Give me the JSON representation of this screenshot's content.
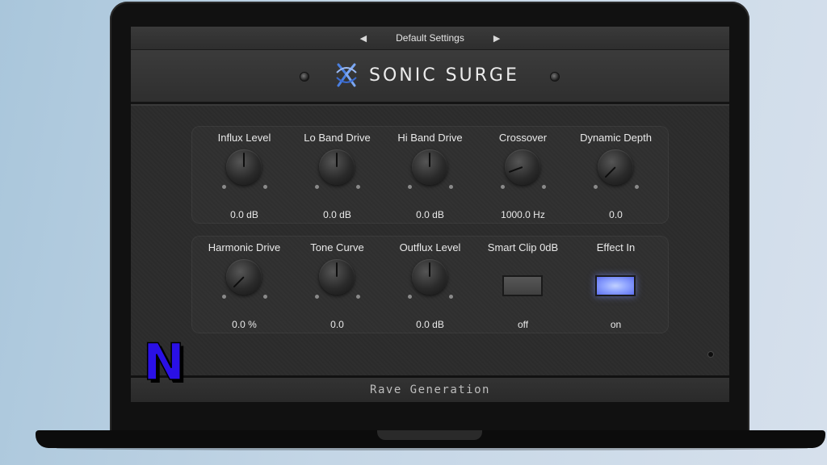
{
  "preset": {
    "name": "Default Settings",
    "prev_icon": "triangle-left-icon",
    "next_icon": "triangle-right-icon"
  },
  "brand": {
    "name": "SONIC SURGE",
    "footer": "Rave Generation",
    "badge": "N"
  },
  "colors": {
    "toggle_on": "#8fa4ff",
    "badge": "#2a10e6",
    "panel": "#2c2c2c"
  },
  "controls_row1": [
    {
      "label": "Influx Level",
      "value": "0.0 dB",
      "knob_angle_deg": 0
    },
    {
      "label": "Lo Band Drive",
      "value": "0.0 dB",
      "knob_angle_deg": 0
    },
    {
      "label": "Hi Band Drive",
      "value": "0.0 dB",
      "knob_angle_deg": 0
    },
    {
      "label": "Crossover",
      "value": "1000.0 Hz",
      "knob_angle_deg": -110
    },
    {
      "label": "Dynamic Depth",
      "value": "0.0",
      "knob_angle_deg": -135
    }
  ],
  "controls_row2": [
    {
      "label": "Harmonic Drive",
      "value": "0.0 %",
      "knob_angle_deg": -135
    },
    {
      "label": "Tone Curve",
      "value": "0.0",
      "knob_angle_deg": 0
    },
    {
      "label": "Outflux Level",
      "value": "0.0 dB",
      "knob_angle_deg": 0
    },
    {
      "label": "Smart Clip 0dB",
      "value": "off",
      "toggle_state": "off"
    },
    {
      "label": "Effect In",
      "value": "on",
      "toggle_state": "on"
    }
  ]
}
